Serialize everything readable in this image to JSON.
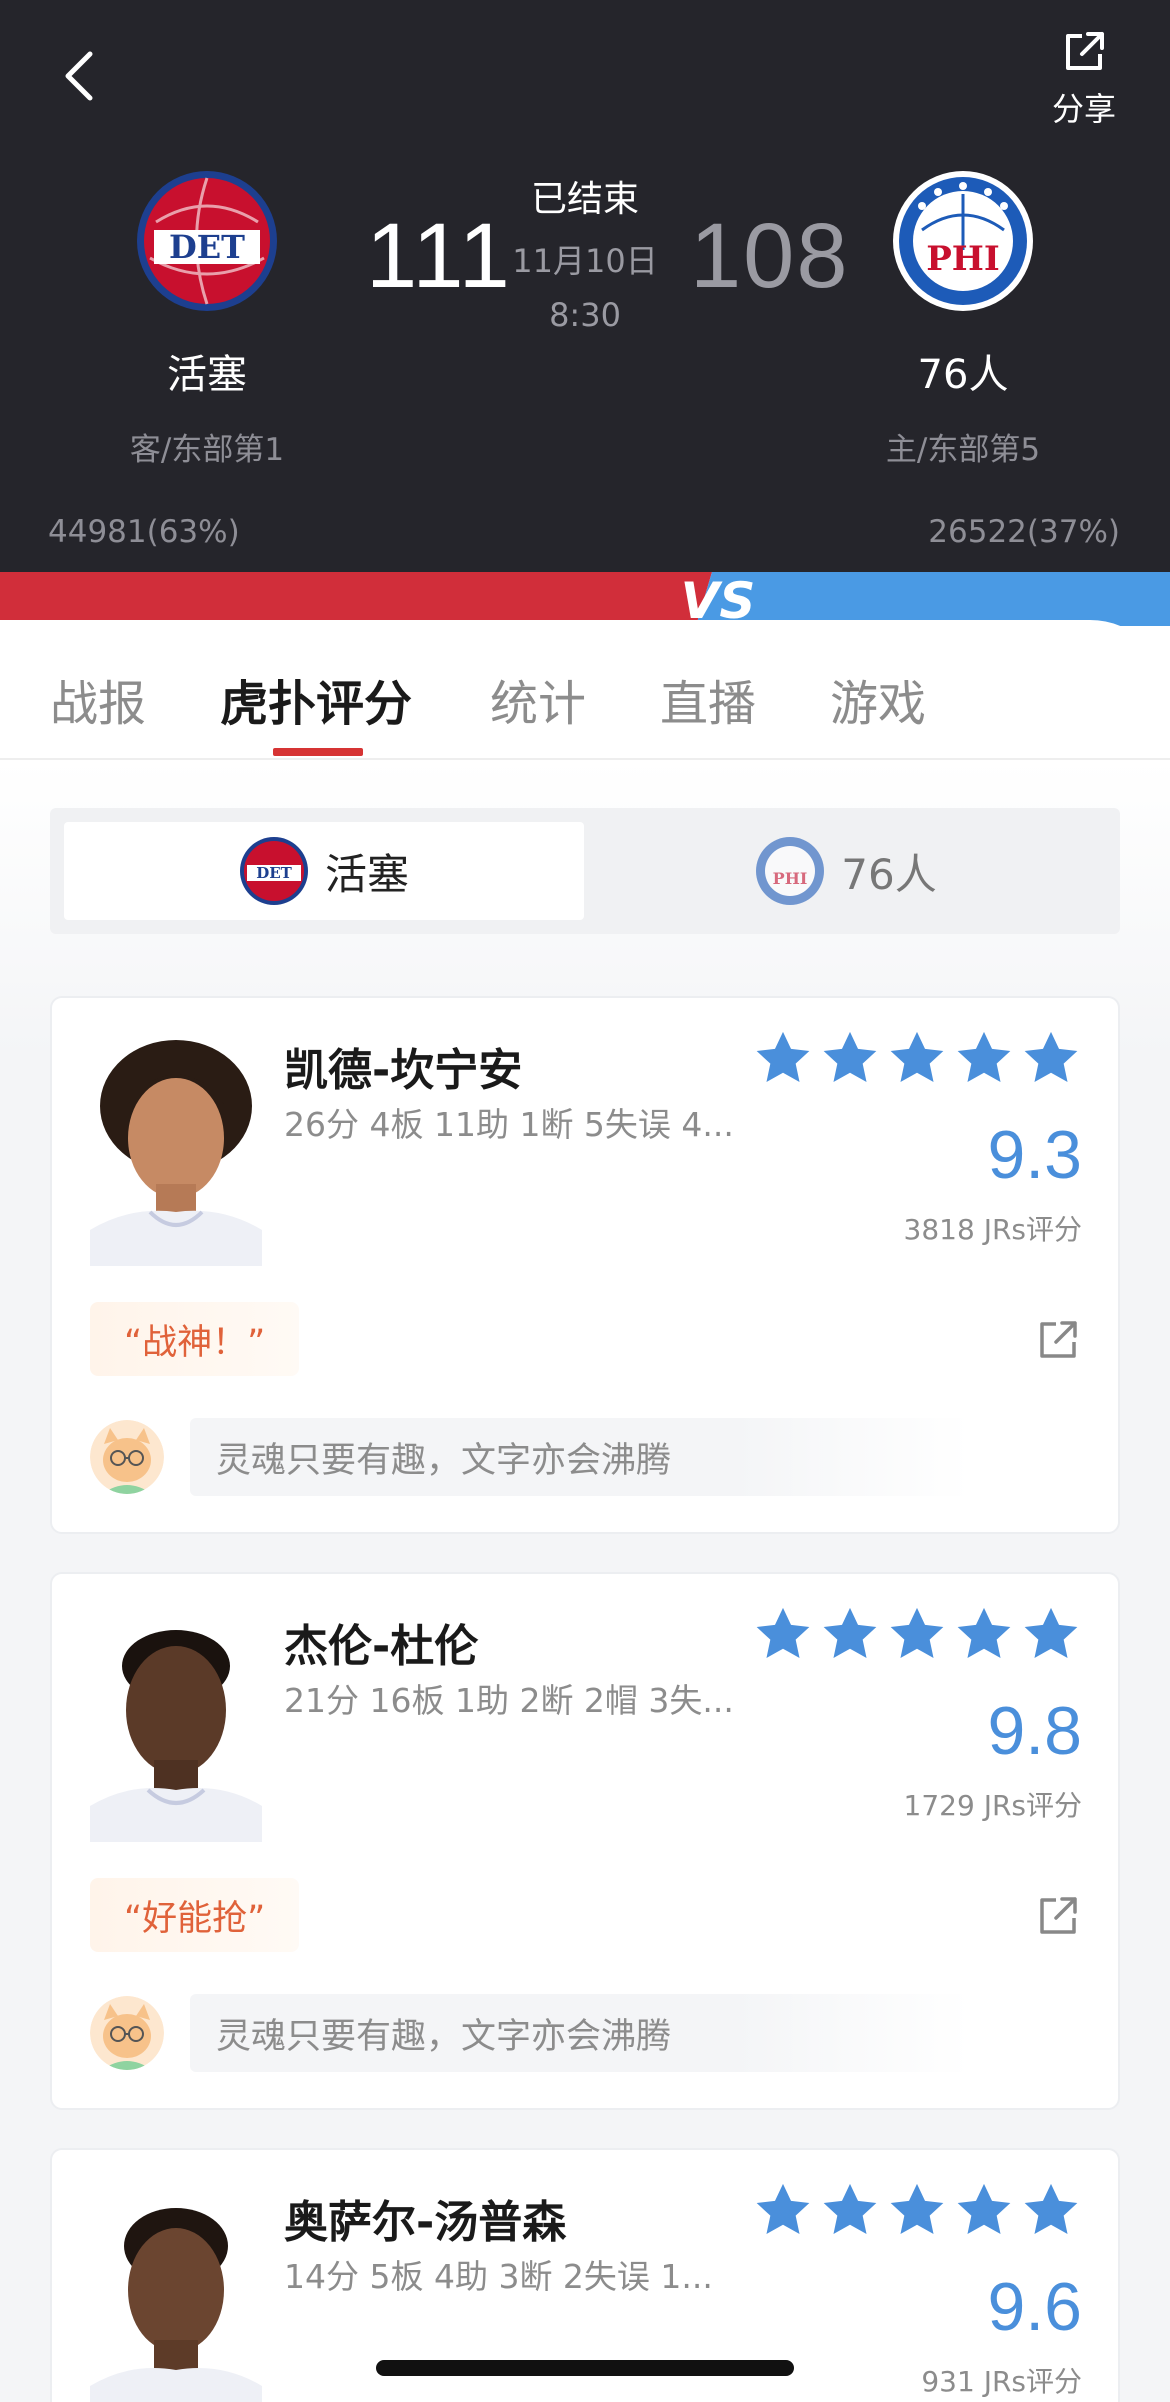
{
  "header": {
    "share_label": "分享",
    "status": "已结束",
    "date": "11月10日",
    "time": "8:30",
    "away": {
      "name": "活塞",
      "score": "111",
      "rank": "客/东部第1",
      "support": "44981(63%)",
      "logo_text": "DET",
      "color": "#c8102e"
    },
    "home": {
      "name": "76人",
      "score": "108",
      "rank": "主/东部第5",
      "support": "26522(37%)",
      "logo_text": "PHI",
      "color": "#1d5bb8"
    }
  },
  "vs_bar": {
    "label": "VS",
    "away_color": "#d12e3a",
    "home_color": "#4a9ae4"
  },
  "tabs": [
    {
      "label": "战报"
    },
    {
      "label": "虎扑评分",
      "active": true
    },
    {
      "label": "统计"
    },
    {
      "label": "直播"
    },
    {
      "label": "游戏"
    }
  ],
  "team_switch": {
    "away": {
      "label": "活塞",
      "selected": true
    },
    "home": {
      "label": "76人",
      "selected": false
    }
  },
  "players": [
    {
      "name": "凯德-坎宁安",
      "stats": "26分 4板 11助 1断 5失误 4...",
      "rating": "9.3",
      "rating_count": "3818 JRs评分",
      "stars": 5,
      "tag": "“战神！”",
      "comment_placeholder": "灵魂只要有趣，文字亦会沸腾"
    },
    {
      "name": "杰伦-杜伦",
      "stats": "21分 16板 1助 2断 2帽 3失...",
      "rating": "9.8",
      "rating_count": "1729 JRs评分",
      "stars": 5,
      "tag": "“好能抢”",
      "comment_placeholder": "灵魂只要有趣，文字亦会沸腾"
    },
    {
      "name": "奥萨尔-汤普森",
      "stats": "14分 5板 4助 3断 2失误 1...",
      "rating": "9.6",
      "rating_count": "931 JRs评分",
      "stars": 5
    }
  ],
  "colors": {
    "accent": "#d63434",
    "rating_blue": "#4a8fdb",
    "header_bg": "#25252b"
  }
}
